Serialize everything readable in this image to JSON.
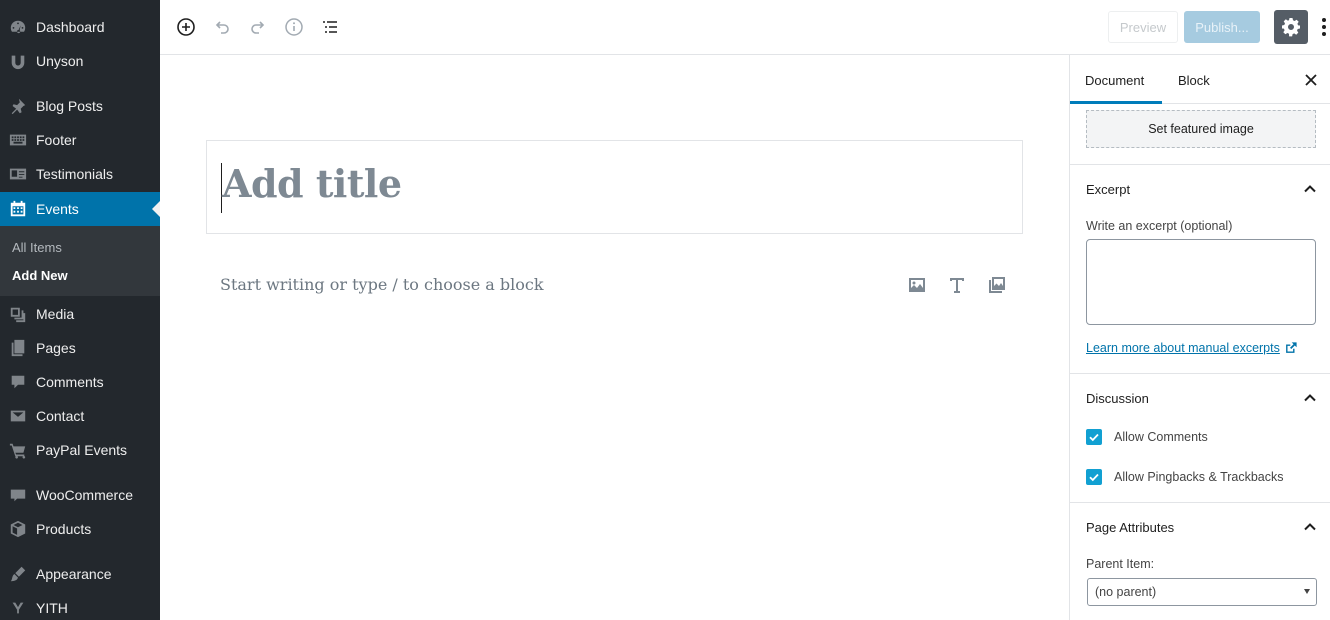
{
  "admin_menu": {
    "items": [
      {
        "label": "Dashboard",
        "icon": "dashboard-icon"
      },
      {
        "label": "Unyson",
        "icon": "unyson-icon"
      },
      {
        "label": "Blog Posts",
        "icon": "pin-icon"
      },
      {
        "label": "Footer",
        "icon": "keyboard-icon"
      },
      {
        "label": "Testimonials",
        "icon": "id-card-icon"
      },
      {
        "label": "Events",
        "icon": "calendar-icon",
        "current": true
      },
      {
        "label": "Media",
        "icon": "media-icon"
      },
      {
        "label": "Pages",
        "icon": "pages-icon"
      },
      {
        "label": "Comments",
        "icon": "comment-icon"
      },
      {
        "label": "Contact",
        "icon": "mail-icon"
      },
      {
        "label": "PayPal Events",
        "icon": "cart-icon"
      },
      {
        "label": "WooCommerce",
        "icon": "woocommerce-icon"
      },
      {
        "label": "Products",
        "icon": "box-icon"
      },
      {
        "label": "Appearance",
        "icon": "brush-icon"
      },
      {
        "label": "YITH",
        "icon": "yith-icon"
      }
    ],
    "submenu": [
      {
        "label": "All Items"
      },
      {
        "label": "Add New",
        "current": true
      }
    ]
  },
  "toolbar": {
    "icons": [
      "add-block-icon",
      "undo-icon",
      "redo-icon",
      "info-icon",
      "outline-icon"
    ],
    "preview_label": "Preview",
    "publish_label": "Publish...",
    "settings_icon": "gear-icon",
    "more_icon": "more-vertical-icon"
  },
  "editor": {
    "title_placeholder": "Add title",
    "block_placeholder": "Start writing or type / to choose a block",
    "inserters": [
      "image-icon",
      "heading-icon",
      "gallery-icon"
    ]
  },
  "settings": {
    "tabs": [
      {
        "label": "Document",
        "active": true
      },
      {
        "label": "Block"
      }
    ],
    "featured_image_button": "Set featured image",
    "excerpt": {
      "title": "Excerpt",
      "field_label": "Write an excerpt (optional)",
      "value": "",
      "learn_more": "Learn more about manual excerpts"
    },
    "discussion": {
      "title": "Discussion",
      "allow_comments": "Allow Comments",
      "allow_pingbacks": "Allow Pingbacks & Trackbacks",
      "comments_checked": true,
      "pingbacks_checked": true
    },
    "page_attributes": {
      "title": "Page Attributes",
      "parent_label": "Parent Item:",
      "parent_value": "(no parent)"
    }
  },
  "colors": {
    "admin_bg": "#23282d",
    "admin_current": "#0073aa",
    "submenu_bg": "#32373c",
    "accent": "#007cba",
    "checkbox": "#11a0d2",
    "publish_disabled": "#a6cbe0"
  }
}
